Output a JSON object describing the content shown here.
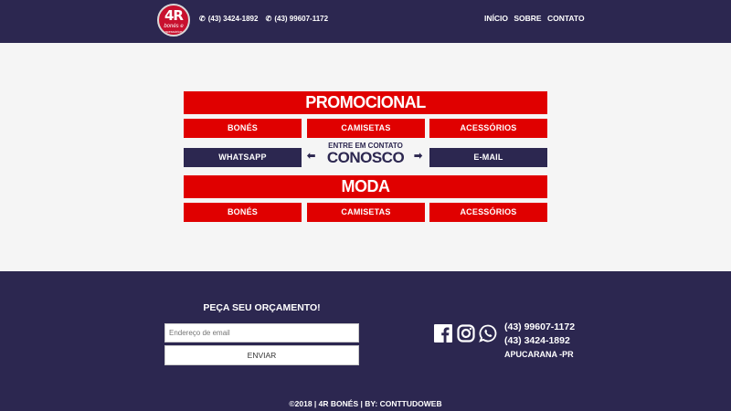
{
  "header": {
    "logo_main": "4R",
    "logo_sub": "bonés e",
    "logo_sub2": "acessórios",
    "phone_1": "(43) 3424-1892",
    "phone_2": "(43) 99607-1172",
    "nav": [
      "INÍCIO",
      "SOBRE",
      "CONTATO"
    ]
  },
  "promo": {
    "title": "PROMOCIONAL",
    "items": [
      "BONÉS",
      "CAMISETAS",
      "ACESSÓRIOS"
    ]
  },
  "contact_row": {
    "whatsapp": "WHATSAPP",
    "small": "ENTRE EM CONTATO",
    "big": "CONOSCO",
    "email": "E-MAIL"
  },
  "moda": {
    "title": "MODA",
    "items": [
      "BONÉS",
      "CAMISETAS",
      "ACESSÓRIOS"
    ]
  },
  "footer": {
    "quote_title": "PEÇA SEU ORÇAMENTO!",
    "email_placeholder": "Endereço de email",
    "send_label": "ENVIAR",
    "phone_1": "(43) 99607-1172",
    "phone_2": "(43) 3424-1892",
    "city": "APUCARANA -PR",
    "copyright": "©2018 | 4R BONÉS | BY: CONTTUDOWEB"
  },
  "colors": {
    "navy": "#2c2750",
    "red": "#e00000"
  },
  "icons": [
    "phone-icon",
    "whatsapp-icon",
    "left-arrow-icon",
    "right-arrow-icon",
    "facebook-icon",
    "instagram-icon"
  ]
}
